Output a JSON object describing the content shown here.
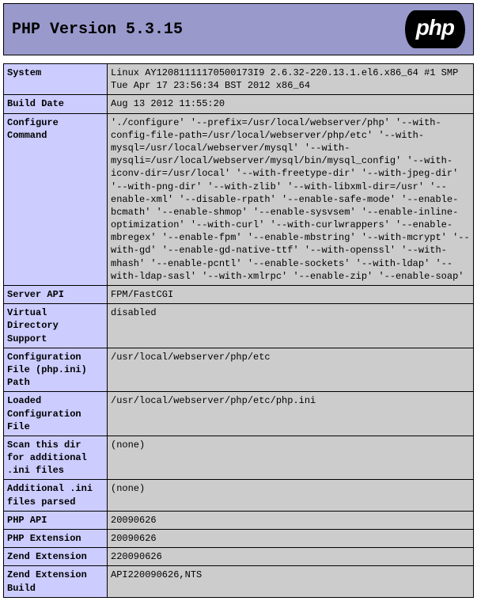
{
  "header": {
    "title": "PHP Version 5.3.15",
    "logo_text": "php"
  },
  "rows": [
    {
      "label": "System",
      "value": "Linux AY12081111170500173I9 2.6.32-220.13.1.el6.x86_64 #1 SMP Tue Apr 17 23:56:34 BST 2012 x86_64"
    },
    {
      "label": "Build Date",
      "value": "Aug 13 2012 11:55:20"
    },
    {
      "label": "Configure Command",
      "value": "'./configure' '--prefix=/usr/local/webserver/php' '--with-config-file-path=/usr/local/webserver/php/etc' '--with-mysql=/usr/local/webserver/mysql' '--with-mysqli=/usr/local/webserver/mysql/bin/mysql_config' '--with-iconv-dir=/usr/local' '--with-freetype-dir' '--with-jpeg-dir' '--with-png-dir' '--with-zlib' '--with-libxml-dir=/usr' '--enable-xml' '--disable-rpath' '--enable-safe-mode' '--enable-bcmath' '--enable-shmop' '--enable-sysvsem' '--enable-inline-optimization' '--with-curl' '--with-curlwrappers' '--enable-mbregex' '--enable-fpm' '--enable-mbstring' '--with-mcrypt' '--with-gd' '--enable-gd-native-ttf' '--with-openssl' '--with-mhash' '--enable-pcntl' '--enable-sockets' '--with-ldap' '--with-ldap-sasl' '--with-xmlrpc' '--enable-zip' '--enable-soap'"
    },
    {
      "label": "Server API",
      "value": "FPM/FastCGI"
    },
    {
      "label": "Virtual Directory Support",
      "value": "disabled"
    },
    {
      "label": "Configuration File (php.ini) Path",
      "value": "/usr/local/webserver/php/etc"
    },
    {
      "label": "Loaded Configuration File",
      "value": "/usr/local/webserver/php/etc/php.ini"
    },
    {
      "label": "Scan this dir for additional .ini files",
      "value": "(none)"
    },
    {
      "label": "Additional .ini files parsed",
      "value": "(none)"
    },
    {
      "label": "PHP API",
      "value": "20090626"
    },
    {
      "label": "PHP Extension",
      "value": "20090626"
    },
    {
      "label": "Zend Extension",
      "value": "220090626"
    },
    {
      "label": "Zend Extension Build",
      "value": "API220090626,NTS"
    }
  ]
}
